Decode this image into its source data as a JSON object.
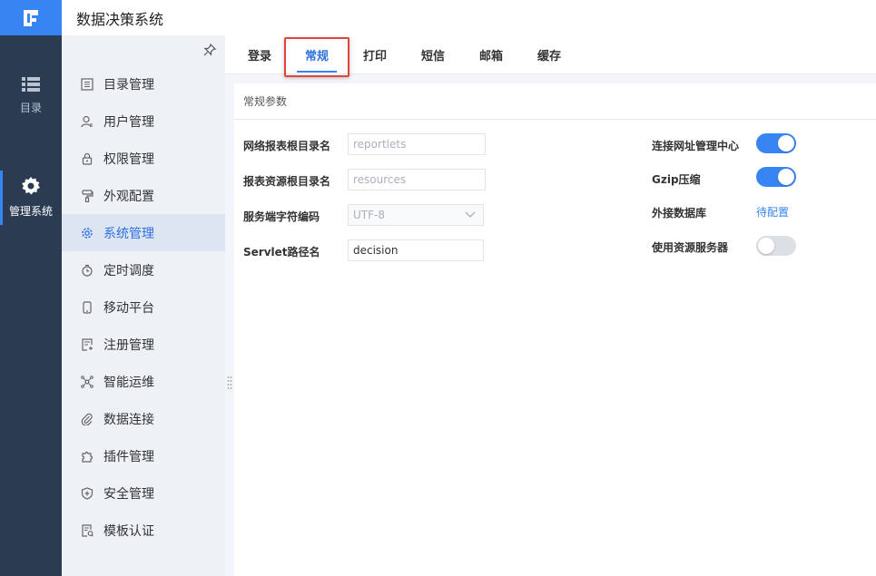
{
  "app": {
    "title": "数据决策系统"
  },
  "rail": {
    "items": [
      {
        "label": "目录",
        "icon": "list-icon"
      },
      {
        "label": "管理系统",
        "icon": "gear-icon"
      }
    ]
  },
  "sidebar": {
    "items": [
      {
        "label": "目录管理",
        "icon": "catalog-icon"
      },
      {
        "label": "用户管理",
        "icon": "user-icon"
      },
      {
        "label": "权限管理",
        "icon": "lock-icon"
      },
      {
        "label": "外观配置",
        "icon": "brush-icon"
      },
      {
        "label": "系统管理",
        "icon": "gear-icon",
        "active": true
      },
      {
        "label": "定时调度",
        "icon": "timer-icon"
      },
      {
        "label": "移动平台",
        "icon": "mobile-icon"
      },
      {
        "label": "注册管理",
        "icon": "register-icon"
      },
      {
        "label": "智能运维",
        "icon": "network-icon"
      },
      {
        "label": "数据连接",
        "icon": "paperclip-icon"
      },
      {
        "label": "插件管理",
        "icon": "puzzle-icon"
      },
      {
        "label": "安全管理",
        "icon": "shield-icon"
      },
      {
        "label": "模板认证",
        "icon": "template-icon"
      }
    ]
  },
  "tabs": [
    {
      "label": "登录"
    },
    {
      "label": "常规",
      "active": true
    },
    {
      "label": "打印"
    },
    {
      "label": "短信"
    },
    {
      "label": "邮箱"
    },
    {
      "label": "缓存"
    }
  ],
  "panel": {
    "title": "常规参数",
    "fields": {
      "report_root": {
        "label": "网络报表根目录名",
        "placeholder": "reportlets"
      },
      "resource_root": {
        "label": "报表资源根目录名",
        "placeholder": "resources"
      },
      "server_encoding": {
        "label": "服务端字符编码",
        "value": "UTF-8"
      },
      "servlet_name": {
        "label": "Servlet路径名",
        "value": "decision"
      }
    },
    "switches": {
      "connect_center": {
        "label": "连接网址管理中心",
        "on": true
      },
      "gzip": {
        "label": "Gzip压缩",
        "on": true
      },
      "external_db": {
        "label": "外接数据库",
        "link": "待配置"
      },
      "resource_server": {
        "label": "使用资源服务器",
        "on": false
      }
    }
  },
  "colors": {
    "accent": "#3685f2",
    "rail": "#2a3b52",
    "highlight": "#e0443a"
  }
}
